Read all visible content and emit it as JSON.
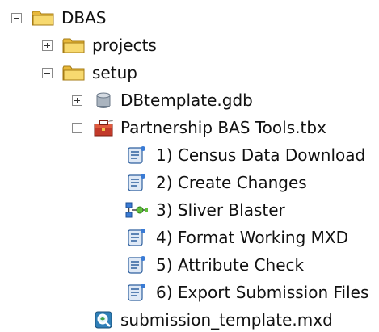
{
  "tree": {
    "root": {
      "label": "DBAS",
      "expanded": true,
      "icon": "folder-icon"
    },
    "projects": {
      "label": "projects",
      "expanded": false,
      "icon": "folder-icon"
    },
    "setup": {
      "label": "setup",
      "expanded": true,
      "icon": "folder-icon"
    },
    "gdb": {
      "label": "DBtemplate.gdb",
      "expanded": false,
      "icon": "geodatabase-icon"
    },
    "toolbox": {
      "label": "Partnership BAS Tools.tbx",
      "expanded": true,
      "icon": "toolbox-icon"
    },
    "tools": [
      {
        "label": "1) Census Data Download",
        "icon": "script-tool-icon"
      },
      {
        "label": "2) Create Changes",
        "icon": "script-tool-icon"
      },
      {
        "label": "3) Sliver Blaster",
        "icon": "model-tool-icon"
      },
      {
        "label": "4) Format Working MXD",
        "icon": "script-tool-icon"
      },
      {
        "label": "5) Attribute Check",
        "icon": "script-tool-icon"
      },
      {
        "label": "6) Export Submission Files",
        "icon": "script-tool-icon"
      }
    ],
    "mxd": {
      "label": "submission_template.mxd",
      "icon": "map-document-icon"
    }
  }
}
